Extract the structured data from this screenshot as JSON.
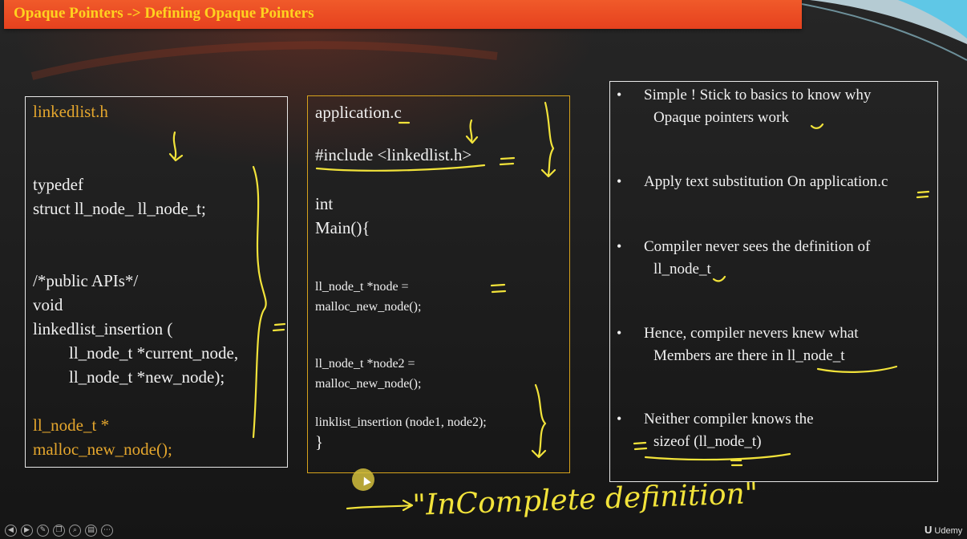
{
  "title": "Opaque Pointers -> Defining Opaque Pointers",
  "colors": {
    "title_bar": "#e6411e",
    "title_text": "#ffd21f",
    "code_highlight": "#e4a62d",
    "annotation_ink": "#f2e33a",
    "mid_panel_border": "#d6a21c"
  },
  "left_panel": {
    "filename": "linkedlist.h",
    "lines": [
      "typedef",
      "struct ll_node_ ll_node_t;",
      "/*public APIs*/",
      "void",
      "linkedlist_insertion (",
      "ll_node_t *current_node,",
      "ll_node_t *new_node);",
      "ll_node_t *",
      "malloc_new_node();"
    ]
  },
  "mid_panel": {
    "filename": "application.c",
    "include": "#include <linkedlist.h>",
    "lines_big": [
      "int",
      "Main(){"
    ],
    "lines_small": [
      "ll_node_t *node =",
      "malloc_new_node();",
      "ll_node_t *node2 =",
      "malloc_new_node();",
      "linklist_insertion (node1, node2);"
    ],
    "closing_brace": "}"
  },
  "right_panel": {
    "bullets": [
      {
        "line1": "Simple ! Stick to basics to know why",
        "line2": "Opaque pointers work"
      },
      {
        "line1": "Apply text substitution On application.c",
        "line2": ""
      },
      {
        "line1": "Compiler never sees the definition of",
        "line2": "ll_node_t"
      },
      {
        "line1": "Hence, compiler nevers knew what",
        "line2": "Members are there in ll_node_t"
      },
      {
        "line1": "Neither compiler knows the",
        "line2": "sizeof (ll_node_t)"
      }
    ],
    "bullet_symbol": "•"
  },
  "annotation": "\"InComplete definition\"",
  "player": {
    "controls": [
      "prev-icon",
      "next-icon",
      "pen-icon",
      "copy-icon",
      "zoom-icon",
      "menu-icon",
      "more-icon"
    ],
    "brand": "Udemy",
    "brand_mark": "U"
  }
}
